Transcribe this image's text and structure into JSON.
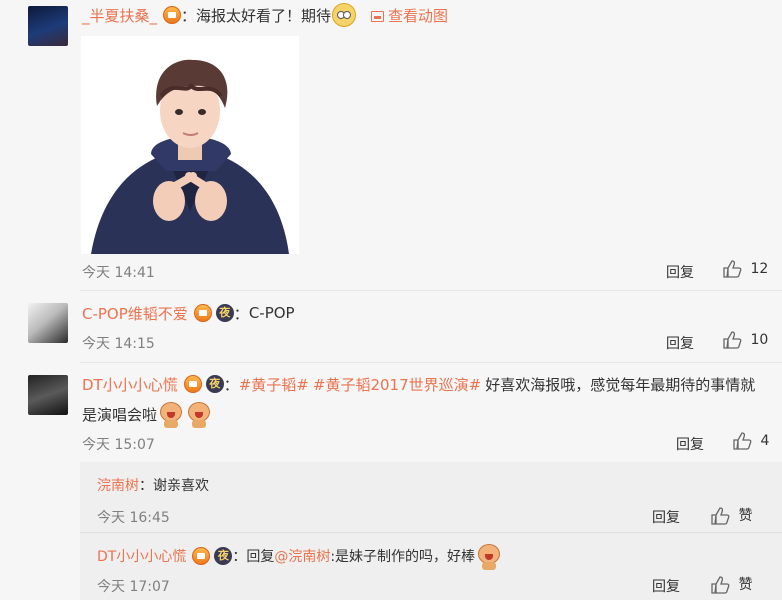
{
  "comments": [
    {
      "username": "_半夏扶桑_",
      "text_prefix": "：",
      "text": "海报太好看了！期待",
      "view_gif_label": "查看动图",
      "time": "今天 14:41",
      "reply_label": "回复",
      "likes": "12"
    },
    {
      "username": "C-POP维韬不爱",
      "text_prefix": "：",
      "text": "C-POP",
      "time": "今天 14:15",
      "reply_label": "回复",
      "likes": "10"
    },
    {
      "username": "DT小小小心慌",
      "text_prefix": "：",
      "hashtag1": "#黄子韬#",
      "hashtag2": "#黄子韬2017世界巡演#",
      "text_line1": "好喜欢海报哦，感觉每年最期待的事情就",
      "text_line2": "是演唱会啦",
      "time": "今天 15:07",
      "reply_label": "回复",
      "likes": "4"
    }
  ],
  "replies": [
    {
      "username": "浣南树",
      "text_prefix": "：",
      "text": "谢亲喜欢",
      "time": "今天 16:45",
      "reply_label": "回复",
      "like_label": "赞"
    },
    {
      "username": "DT小小小心慌",
      "text_prefix": "：回复",
      "mention": "@浣南树",
      "text": ":是妹子制作的吗，好棒",
      "time": "今天 17:07",
      "reply_label": "回复",
      "like_label": "赞"
    }
  ],
  "badges": {
    "night_glyph": "夜"
  },
  "colors": {
    "username": "#eb7350",
    "background": "#f6f6f6",
    "reply_background": "#efefef"
  }
}
